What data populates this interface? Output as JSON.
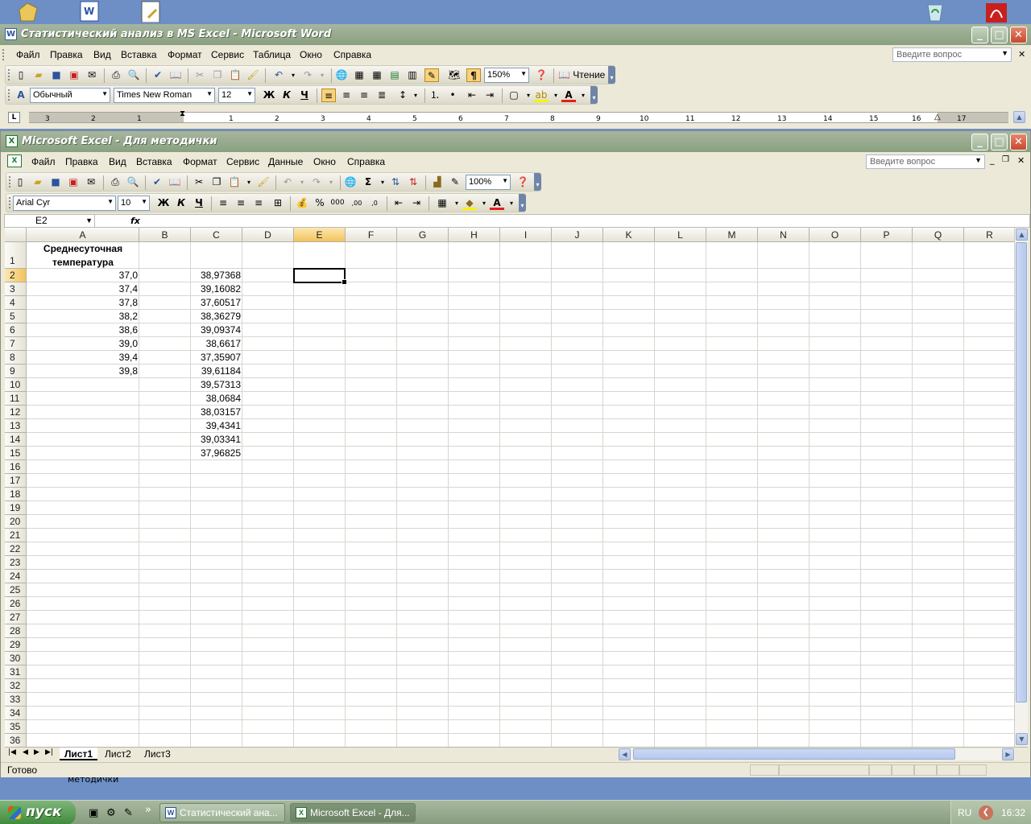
{
  "word": {
    "title": "Статистический анализ в MS Excel - Microsoft Word",
    "menu": [
      "Файл",
      "Правка",
      "Вид",
      "Вставка",
      "Формат",
      "Сервис",
      "Таблица",
      "Окно",
      "Справка"
    ],
    "ask_placeholder": "Введите вопрос",
    "zoom": "150%",
    "reading_label": "Чтение",
    "style": "Обычный",
    "font": "Times New Roman",
    "size": "12",
    "ruler_ticks": [
      "3",
      "2",
      "1",
      "1",
      "2",
      "3",
      "4",
      "5",
      "6",
      "7",
      "8",
      "9",
      "10",
      "11",
      "12",
      "13",
      "14",
      "15",
      "16",
      "17"
    ],
    "tab_selector": "L"
  },
  "excel": {
    "title": "Microsoft Excel - Для методички",
    "menu": [
      "Файл",
      "Правка",
      "Вид",
      "Вставка",
      "Формат",
      "Сервис",
      "Данные",
      "Окно",
      "Справка"
    ],
    "ask_placeholder": "Введите вопрос",
    "zoom": "100%",
    "font": "Arial Cyr",
    "size": "10",
    "name_box": "E2",
    "fx_label": "fx",
    "columns": [
      "A",
      "B",
      "C",
      "D",
      "E",
      "F",
      "G",
      "H",
      "I",
      "J",
      "K",
      "L",
      "M",
      "N",
      "O",
      "P",
      "Q",
      "R"
    ],
    "rows": [
      "1",
      "2",
      "3",
      "4",
      "5",
      "6",
      "7",
      "8",
      "9",
      "10",
      "11",
      "12",
      "13",
      "14",
      "15",
      "16",
      "17",
      "18",
      "19",
      "20",
      "21",
      "22",
      "23",
      "24",
      "25",
      "26",
      "27",
      "28",
      "29",
      "30",
      "31",
      "32",
      "33",
      "34",
      "35",
      "36"
    ],
    "header_A1": [
      "Среднесуточная",
      "температура"
    ],
    "col_A": [
      "37,0",
      "37,4",
      "37,8",
      "38,2",
      "38,6",
      "39,0",
      "39,4",
      "39,8"
    ],
    "col_C": [
      "38,97368",
      "39,16082",
      "37,60517",
      "38,36279",
      "39,09374",
      "38,6617",
      "37,35907",
      "39,61184",
      "39,57313",
      "38,0684",
      "38,03157",
      "39,4341",
      "39,03341",
      "37,96825"
    ],
    "sheets": [
      "Лист1",
      "Лист2",
      "Лист3"
    ],
    "status": "Готово"
  },
  "desktop": {
    "label_below": "методички"
  },
  "taskbar": {
    "start": "пуск",
    "buttons": [
      "Статистический ана...",
      "Microsoft Excel - Для..."
    ],
    "lang": "RU",
    "time": "16:32"
  },
  "colors": {
    "title_bar": "#8aa07f",
    "selected_header": "#f4c35b",
    "desktop": "#6d8fc6"
  }
}
